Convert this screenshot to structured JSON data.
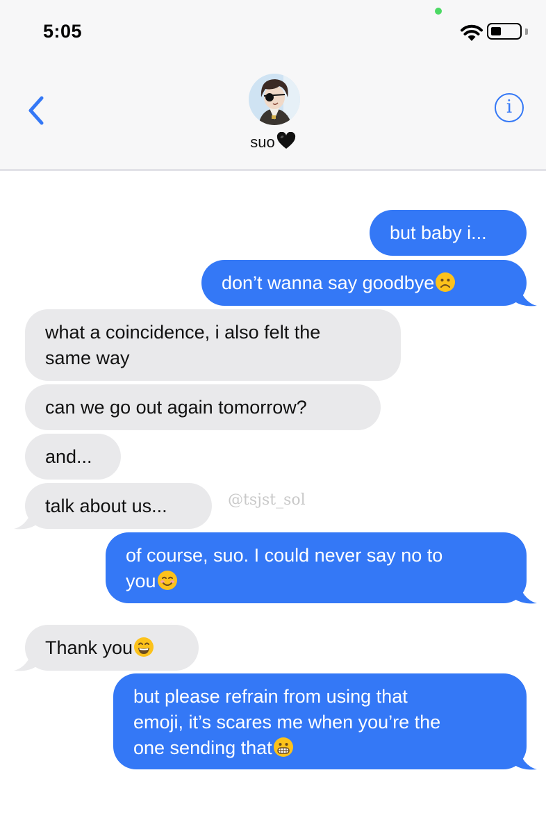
{
  "status_bar": {
    "time": "5:05"
  },
  "header": {
    "contact_name": "suo",
    "name_emoji": "black-heart-emoji"
  },
  "messages": [
    {
      "side": "sent",
      "text": "but baby i...",
      "emoji": ""
    },
    {
      "side": "sent",
      "text": "don’t wanna say goodbye",
      "emoji": "frowning-face-emoji"
    },
    {
      "side": "received",
      "line1": "what a coincidence, i also felt the",
      "line2": "same way"
    },
    {
      "side": "received",
      "text": "can we go out again tomorrow?"
    },
    {
      "side": "received",
      "text": "and..."
    },
    {
      "side": "received",
      "text": "talk about us..."
    },
    {
      "side": "sent",
      "line1": "of course, suo. I could never say no to",
      "line2": "you",
      "emoji": "smiling-face-emoji"
    },
    {
      "side": "received",
      "text": "Thank you",
      "emoji": "grinning-face-emoji"
    },
    {
      "side": "sent",
      "line1": "but please refrain from using that",
      "line2": "emoji, it’s scares me when you’re the",
      "line3": "one sending that",
      "emoji": "grimacing-face-emoji"
    }
  ],
  "watermark": "@tsjst_sol",
  "colors": {
    "sent_bubble": "#3478f6",
    "received_bubble": "#e9e9eb",
    "accent": "#3478f6"
  }
}
